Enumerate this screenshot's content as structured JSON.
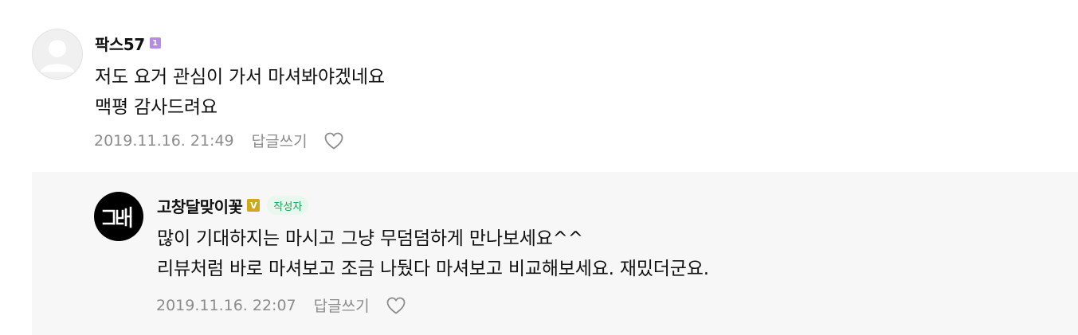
{
  "comments": [
    {
      "nickname": "팍스57",
      "level_badge": "1",
      "lines": [
        "저도 요거 관심이 가서 마셔봐야겠네요",
        "맥평 감사드려요"
      ],
      "date": "2019.11.16. 21:49",
      "reply_label": "답글쓰기",
      "avatar_icon": "default-user-icon"
    },
    {
      "nickname": "고창달맞이꽃",
      "verified_badge": "V",
      "writer_badge": "작성자",
      "lines": [
        "많이 기대하지는 마시고 그냥 무덤덤하게 만나보세요^^",
        "리뷰처럼 바로 마셔보고 조금 나뒀다 마셔보고 비교해보세요. 재밌더군요."
      ],
      "date": "2019.11.16. 22:07",
      "reply_label": "답글쓰기",
      "avatar_icon": "author-logo-icon"
    }
  ],
  "colors": {
    "reply_background": "#f7f7f7",
    "meta_text": "#8c8c8c",
    "level_badge": "#b58be6",
    "verified_badge": "#d1a81c",
    "writer_badge_bg": "#e9f8ee",
    "writer_badge_text": "#1aa45a"
  },
  "icons": {
    "like": "heart-outline-icon"
  }
}
